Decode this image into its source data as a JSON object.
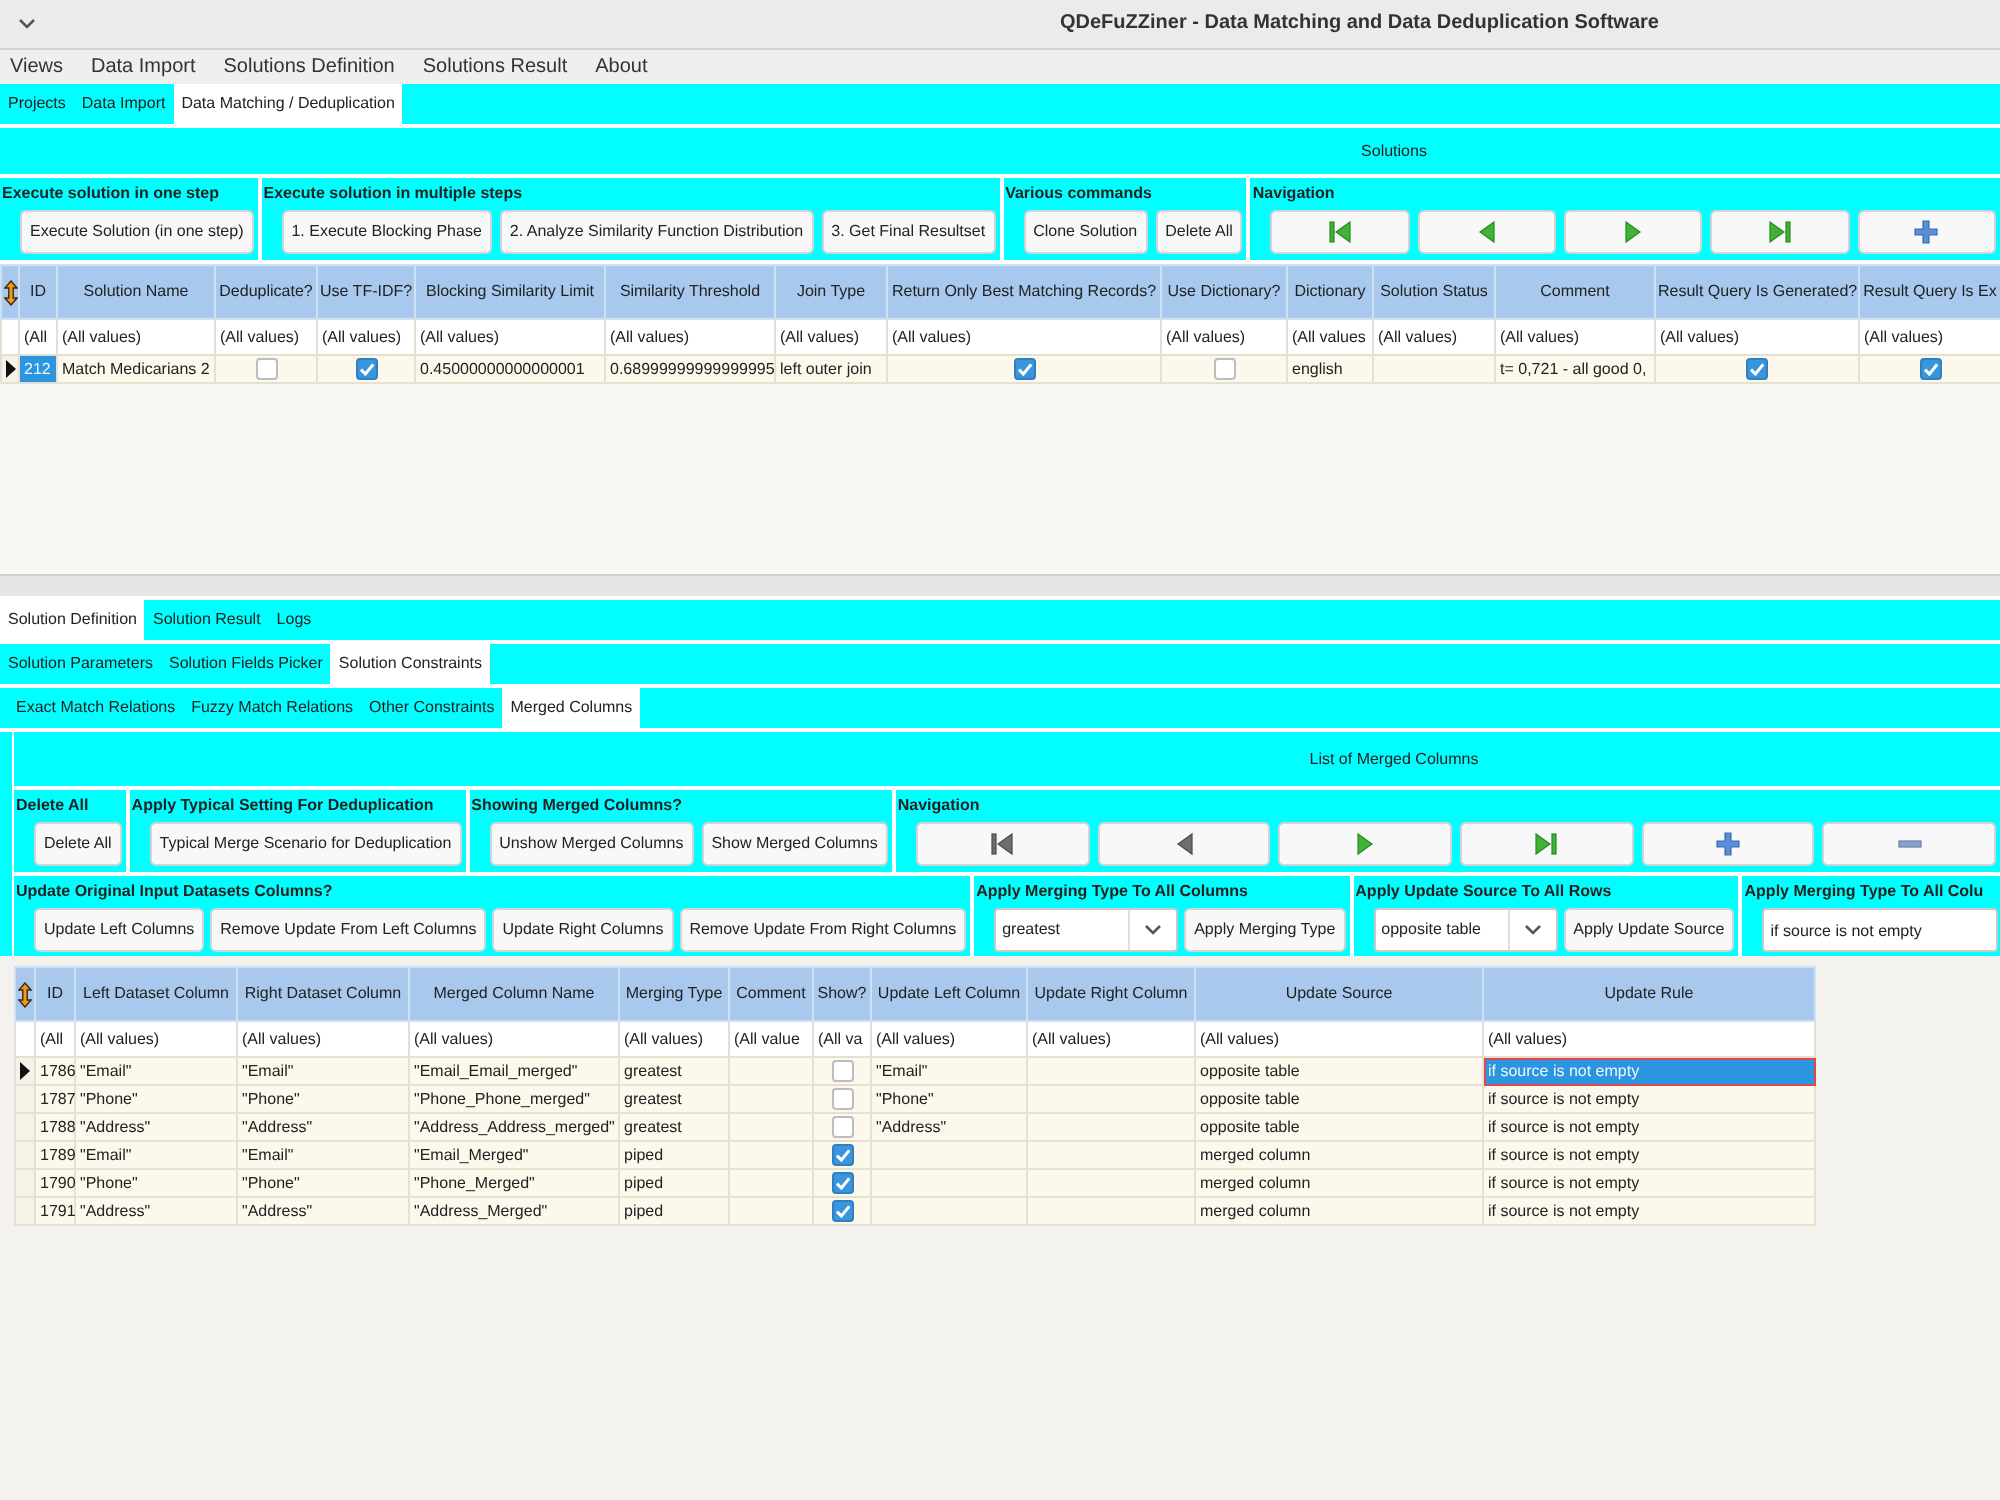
{
  "window": {
    "title": "QDeFuZZiner - Data Matching and Data Deduplication Software"
  },
  "menu": [
    {
      "label": "Views"
    },
    {
      "label": "Data Import"
    },
    {
      "label": "Solutions Definition"
    },
    {
      "label": "Solutions Result"
    },
    {
      "label": "About"
    }
  ],
  "main_tabs": [
    {
      "label": "Projects",
      "selected": false
    },
    {
      "label": "Data Import",
      "selected": false
    },
    {
      "label": "Data Matching / Deduplication",
      "selected": true
    }
  ],
  "solutions": {
    "title": "Solutions",
    "groups": [
      {
        "title": "Execute solution in one step",
        "items": [
          {
            "kind": "button",
            "label": "Execute Solution (in one step)"
          }
        ]
      },
      {
        "title": "Execute solution in multiple steps",
        "items": [
          {
            "kind": "button",
            "label": "1. Execute Blocking Phase"
          },
          {
            "kind": "button",
            "label": "2. Analyze Similarity Function Distribution"
          },
          {
            "kind": "button",
            "label": "3. Get Final Resultset"
          }
        ]
      },
      {
        "title": "Various commands",
        "items": [
          {
            "kind": "button",
            "label": "Clone Solution"
          },
          {
            "kind": "button",
            "label": "Delete All"
          }
        ]
      },
      {
        "title": "Navigation",
        "items": [
          {
            "kind": "first",
            "disabled": false
          },
          {
            "kind": "previous",
            "disabled": false
          },
          {
            "kind": "next",
            "disabled": false
          },
          {
            "kind": "last",
            "disabled": false
          },
          {
            "kind": "add",
            "disabled": false
          }
        ]
      }
    ],
    "table": {
      "focused": false,
      "columns": [
        {
          "label": "ID",
          "kind": "text"
        },
        {
          "label": "Solution Name",
          "kind": "text"
        },
        {
          "label": "Deduplicate?",
          "kind": "check"
        },
        {
          "label": "Use TF-IDF?",
          "kind": "check"
        },
        {
          "label": "Blocking Similarity Limit",
          "kind": "text"
        },
        {
          "label": "Similarity Threshold",
          "kind": "text"
        },
        {
          "label": "Join Type",
          "kind": "text"
        },
        {
          "label": "Return Only Best Matching Records?",
          "kind": "check"
        },
        {
          "label": "Use Dictionary?",
          "kind": "check"
        },
        {
          "label": "Dictionary",
          "kind": "text"
        },
        {
          "label": "Solution Status",
          "kind": "text"
        },
        {
          "label": "Comment",
          "kind": "text"
        },
        {
          "label": "Result Query Is Generated?",
          "kind": "check"
        },
        {
          "label": "Result Query Is Ex",
          "kind": "check"
        }
      ],
      "filters": [
        "(All",
        "(All values)",
        "(All values)",
        "(All values)",
        "(All values)",
        "(All values)",
        "(All values)",
        "(All values)",
        "(All values)",
        "(All values",
        "(All values)",
        "(All values)",
        "(All values)",
        "(All values)"
      ],
      "rows": [
        {
          "current": true,
          "cells": [
            {
              "text": "212",
              "selected": true
            },
            {
              "text": "Match Medicarians 2",
              "selected": false
            },
            {
              "checked": false,
              "selected": false
            },
            {
              "checked": true,
              "selected": false
            },
            {
              "text": "0.45000000000000001",
              "selected": false
            },
            {
              "text": "0.68999999999999995",
              "selected": false
            },
            {
              "text": "left outer join",
              "selected": false
            },
            {
              "checked": true,
              "selected": false
            },
            {
              "checked": false,
              "selected": false
            },
            {
              "text": "english",
              "selected": false
            },
            {
              "selected": false
            },
            {
              "text": "t= 0,721 - all good 0,",
              "selected": false
            },
            {
              "checked": true,
              "selected": false
            },
            {
              "checked": true,
              "selected": false
            }
          ]
        }
      ]
    }
  },
  "bottom_tabs": [
    {
      "label": "Solution Definition",
      "selected": true
    },
    {
      "label": "Solution Result",
      "selected": false
    },
    {
      "label": "Logs",
      "selected": false
    }
  ],
  "definition_tabs": [
    {
      "label": "Solution Parameters",
      "selected": false
    },
    {
      "label": "Solution Fields Picker",
      "selected": false
    },
    {
      "label": "Solution Constraints",
      "selected": true
    }
  ],
  "constraint_tabs": [
    {
      "label": "Exact Match Relations",
      "selected": false
    },
    {
      "label": "Fuzzy Match Relations",
      "selected": false
    },
    {
      "label": "Other Constraints",
      "selected": false
    },
    {
      "label": "Merged Columns",
      "selected": true
    }
  ],
  "merged_columns": {
    "title": "List of Merged Columns",
    "toolbar_rows": [
      {
        "groups": [
          {
            "title": "Delete All",
            "items": [
              {
                "kind": "button",
                "label": "Delete All"
              }
            ]
          },
          {
            "title": "Apply Typical Setting For Deduplication",
            "items": [
              {
                "kind": "button",
                "label": "Typical Merge Scenario for Deduplication"
              }
            ]
          },
          {
            "title": "Showing Merged Columns?",
            "items": [
              {
                "kind": "button",
                "label": "Unshow Merged Columns"
              },
              {
                "kind": "button",
                "label": "Show Merged Columns"
              }
            ]
          },
          {
            "title": "Navigation",
            "items": [
              {
                "kind": "first",
                "disabled": true
              },
              {
                "kind": "previous",
                "disabled": true
              },
              {
                "kind": "next",
                "disabled": false
              },
              {
                "kind": "last",
                "disabled": false
              },
              {
                "kind": "add",
                "disabled": false
              },
              {
                "kind": "remove",
                "disabled": false
              }
            ]
          }
        ]
      },
      {
        "groups": [
          {
            "title": "Update Original Input Datasets Columns?",
            "items": [
              {
                "kind": "button",
                "label": "Update Left Columns"
              },
              {
                "kind": "button",
                "label": "Remove Update From Left Columns"
              },
              {
                "kind": "button",
                "label": "Update Right Columns"
              },
              {
                "kind": "button",
                "label": "Remove Update From Right Columns"
              }
            ]
          },
          {
            "title": "Apply Merging Type To All Columns",
            "items": [
              {
                "kind": "combo",
                "value": "greatest"
              },
              {
                "kind": "button",
                "label": "Apply Merging Type"
              }
            ]
          },
          {
            "title": "Apply Update Source To All Rows",
            "items": [
              {
                "kind": "combo",
                "value": "opposite table"
              },
              {
                "kind": "button",
                "label": "Apply Update Source"
              }
            ]
          },
          {
            "title": "Apply Merging Type To All Colu",
            "items": [
              {
                "kind": "field",
                "value": "if source is not empty"
              }
            ]
          }
        ]
      }
    ],
    "table": {
      "focused": true,
      "columns": [
        {
          "label": "ID",
          "kind": "text"
        },
        {
          "label": "Left Dataset Column",
          "kind": "text"
        },
        {
          "label": "Right Dataset Column",
          "kind": "text"
        },
        {
          "label": "Merged Column Name",
          "kind": "text"
        },
        {
          "label": "Merging Type",
          "kind": "text"
        },
        {
          "label": "Comment",
          "kind": "text"
        },
        {
          "label": "Show?",
          "kind": "check"
        },
        {
          "label": "Update Left Column",
          "kind": "text"
        },
        {
          "label": "Update Right Column",
          "kind": "text"
        },
        {
          "label": "Update Source",
          "kind": "text"
        },
        {
          "label": "Update Rule",
          "kind": "text"
        }
      ],
      "filters": [
        "(All",
        "(All values)",
        "(All values)",
        "(All values)",
        "(All values)",
        "(All value",
        "(All va",
        "(All values)",
        "(All values)",
        "(All values)",
        "(All values)"
      ],
      "rows": [
        {
          "current": true,
          "cells": [
            {
              "text": "1786",
              "selected": false
            },
            {
              "text": "\"Email\"",
              "selected": false
            },
            {
              "text": "\"Email\"",
              "selected": false
            },
            {
              "text": "\"Email_Email_merged\"",
              "selected": false
            },
            {
              "text": "greatest",
              "selected": false
            },
            {
              "selected": false
            },
            {
              "checked": false,
              "selected": false
            },
            {
              "text": "\"Email\"",
              "selected": false
            },
            {
              "selected": false
            },
            {
              "text": "opposite table",
              "selected": false
            },
            {
              "text": "if source is not empty",
              "selected": true
            }
          ]
        },
        {
          "current": false,
          "cells": [
            {
              "text": "1787",
              "selected": false
            },
            {
              "text": "\"Phone\"",
              "selected": false
            },
            {
              "text": "\"Phone\"",
              "selected": false
            },
            {
              "text": "\"Phone_Phone_merged\"",
              "selected": false
            },
            {
              "text": "greatest",
              "selected": false
            },
            {
              "selected": false
            },
            {
              "checked": false,
              "selected": false
            },
            {
              "text": "\"Phone\"",
              "selected": false
            },
            {
              "selected": false
            },
            {
              "text": "opposite table",
              "selected": false
            },
            {
              "text": "if source is not empty",
              "selected": false
            }
          ]
        },
        {
          "current": false,
          "cells": [
            {
              "text": "1788",
              "selected": false
            },
            {
              "text": "\"Address\"",
              "selected": false
            },
            {
              "text": "\"Address\"",
              "selected": false
            },
            {
              "text": "\"Address_Address_merged\"",
              "selected": false
            },
            {
              "text": "greatest",
              "selected": false
            },
            {
              "selected": false
            },
            {
              "checked": false,
              "selected": false
            },
            {
              "text": "\"Address\"",
              "selected": false
            },
            {
              "selected": false
            },
            {
              "text": "opposite table",
              "selected": false
            },
            {
              "text": "if source is not empty",
              "selected": false
            }
          ]
        },
        {
          "current": false,
          "cells": [
            {
              "text": "1789",
              "selected": false
            },
            {
              "text": "\"Email\"",
              "selected": false
            },
            {
              "text": "\"Email\"",
              "selected": false
            },
            {
              "text": "\"Email_Merged\"",
              "selected": false
            },
            {
              "text": "piped",
              "selected": false
            },
            {
              "selected": false
            },
            {
              "checked": true,
              "selected": false
            },
            {
              "selected": false
            },
            {
              "selected": false
            },
            {
              "text": "merged column",
              "selected": false
            },
            {
              "text": "if source is not empty",
              "selected": false
            }
          ]
        },
        {
          "current": false,
          "cells": [
            {
              "text": "1790",
              "selected": false
            },
            {
              "text": "\"Phone\"",
              "selected": false
            },
            {
              "text": "\"Phone\"",
              "selected": false
            },
            {
              "text": "\"Phone_Merged\"",
              "selected": false
            },
            {
              "text": "piped",
              "selected": false
            },
            {
              "selected": false
            },
            {
              "checked": true,
              "selected": false
            },
            {
              "selected": false
            },
            {
              "selected": false
            },
            {
              "text": "merged column",
              "selected": false
            },
            {
              "text": "if source is not empty",
              "selected": false
            }
          ]
        },
        {
          "current": false,
          "cells": [
            {
              "text": "1791",
              "selected": false
            },
            {
              "text": "\"Address\"",
              "selected": false
            },
            {
              "text": "\"Address\"",
              "selected": false
            },
            {
              "text": "\"Address_Merged\"",
              "selected": false
            },
            {
              "text": "piped",
              "selected": false
            },
            {
              "selected": false
            },
            {
              "checked": true,
              "selected": false
            },
            {
              "selected": false
            },
            {
              "selected": false
            },
            {
              "text": "merged column",
              "selected": false
            },
            {
              "text": "if source is not empty",
              "selected": false
            }
          ]
        }
      ]
    }
  }
}
